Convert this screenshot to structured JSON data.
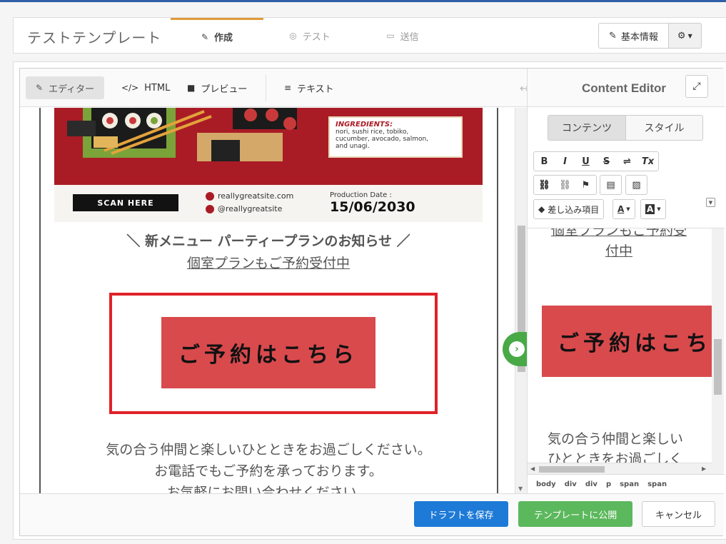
{
  "header": {
    "title": "テストテンプレート",
    "tabs": [
      {
        "label": "作成",
        "icon": "edit-icon"
      },
      {
        "label": "テスト",
        "icon": "target-icon"
      },
      {
        "label": "送信",
        "icon": "inbox-icon"
      }
    ],
    "basic_info_label": "基本情報"
  },
  "toolbar": {
    "editor_label": "エディター",
    "html_label": "HTML",
    "preview_label": "プレビュー",
    "text_label": "テキスト"
  },
  "banner": {
    "ingredients_title": "INGREDIENTS:",
    "ingredients_lines": [
      "nori, sushi rice, tobiko,",
      "cucumber, avocado, salmon,",
      "and unagi."
    ],
    "scan_label": "SCAN HERE",
    "website": "reallygreatsite.com",
    "social": "@reallygreatsite",
    "production_label": "Production Date :",
    "production_date": "15/06/2030"
  },
  "content": {
    "announce": "＼ 新メニュー パーティープランのお知らせ ／",
    "subline": "個室プランもご予約受付中",
    "cta": "ご予約はこちら",
    "body_lines": [
      "気の合う仲間と楽しいひとときをお過ごしください。",
      "お電話でもご予約を承っております。",
      "お気軽にお問い合わせください。"
    ]
  },
  "right_panel": {
    "title": "Content Editor",
    "seg_content": "コンテンツ",
    "seg_style": "スタイル",
    "tag_button": "差し込み項目",
    "preview_lines": [
      "個室プランもご予約受",
      "付中"
    ],
    "preview_cta": "ご予約はこち",
    "preview_body": [
      "気の合う仲間と楽しい",
      "ひとときをお過ごしく"
    ],
    "path": [
      "body",
      "div",
      "div",
      "p",
      "span",
      "span"
    ]
  },
  "footer": {
    "draft_label": "ドラフトを保存",
    "publish_label": "テンプレートに公開",
    "cancel_label": "キャンセル"
  },
  "colors": {
    "accent_tab": "#e09b3a",
    "draft": "#1d7ad6",
    "publish": "#5cb85c",
    "cta": "#d94a4d",
    "selection": "#e02128",
    "banner": "#a91c25"
  }
}
